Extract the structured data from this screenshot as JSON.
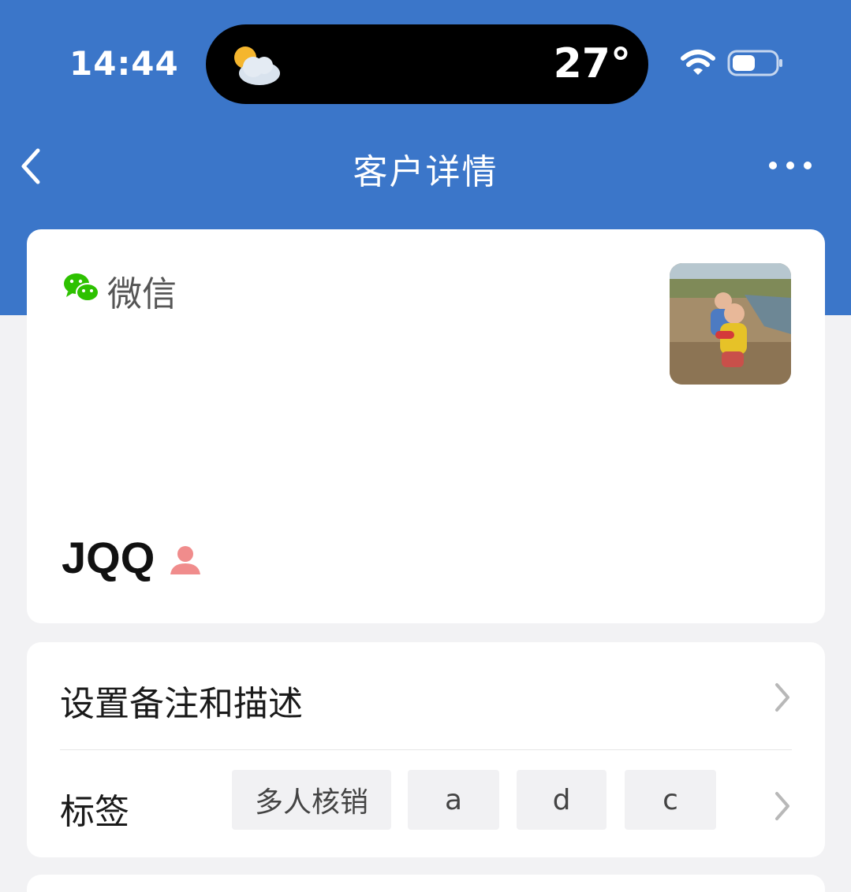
{
  "status_bar": {
    "time": "14:44",
    "temperature": "27°",
    "weather_icon": "partly-cloudy-icon",
    "wifi_icon": "wifi-icon",
    "battery_icon": "battery-icon"
  },
  "nav": {
    "title": "客户详情",
    "back_icon": "chevron-left-icon",
    "more_icon": "more-icon"
  },
  "profile": {
    "source_label": "微信",
    "source_icon": "wechat-icon",
    "name": "JQQ",
    "gender_icon": "person-icon"
  },
  "settings": {
    "remark_label": "设置备注和描述",
    "tags_label": "标签",
    "tags": [
      "多人核销",
      "a",
      "d",
      "c"
    ]
  },
  "colors": {
    "header_blue": "#3b76c9",
    "wechat_green": "#2dc100",
    "gender_pink": "#f08c8c"
  }
}
